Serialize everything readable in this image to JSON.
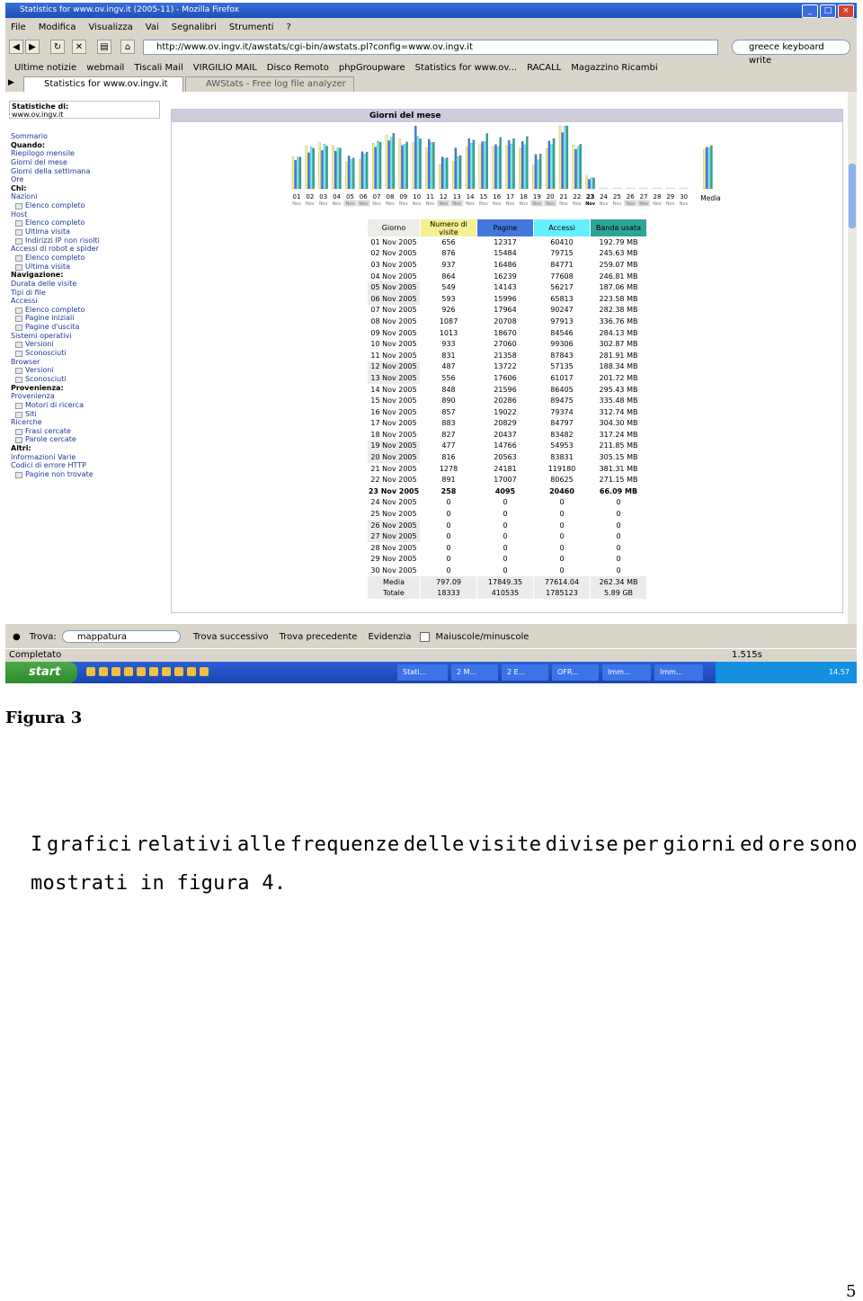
{
  "window": {
    "title": "Statistics for www.ov.ingv.it (2005-11) - Mozilla Firefox",
    "controls": [
      "_",
      "□",
      "×"
    ]
  },
  "menu": [
    "File",
    "Modifica",
    "Visualizza",
    "Vai",
    "Segnalibri",
    "Strumenti",
    "?"
  ],
  "navbar": {
    "url": "http://www.ov.ingv.it/awstats/cgi-bin/awstats.pl?config=www.ov.ingv.it",
    "search": "greece keyboard write"
  },
  "bookmarks": [
    "Ultime notizie",
    "webmail",
    "Tiscali Mail",
    "VIRGILIO MAIL",
    "Disco Remoto",
    "phpGroupware",
    "Statistics for www.ov...",
    "RACALL",
    "Magazzino Ricambi"
  ],
  "tabs": [
    "Statistics for www.ov.ingv.it (20...",
    "AWStats - Free log file analyzer ..."
  ],
  "sidebar": {
    "stats_label": "Statistiche di:",
    "site": "www.ov.ingv.it",
    "items": [
      {
        "t": "Sommario",
        "k": "link"
      },
      {
        "t": "Quando:",
        "k": "head"
      },
      {
        "t": "Riepilogo mensile",
        "k": "link"
      },
      {
        "t": "Giorni del mese",
        "k": "link"
      },
      {
        "t": "Giorni della settimana",
        "k": "link"
      },
      {
        "t": "Ore",
        "k": "link"
      },
      {
        "t": "Chi:",
        "k": "head"
      },
      {
        "t": "Nazioni",
        "k": "link"
      },
      {
        "t": "Elenco completo",
        "k": "sub"
      },
      {
        "t": "Host",
        "k": "link"
      },
      {
        "t": "Elenco completo",
        "k": "sub"
      },
      {
        "t": "Ultima visita",
        "k": "sub"
      },
      {
        "t": "Indirizzi IP non risolti",
        "k": "sub"
      },
      {
        "t": "Accessi di robot e spider",
        "k": "link"
      },
      {
        "t": "Elenco completo",
        "k": "sub"
      },
      {
        "t": "Ultima visita",
        "k": "sub"
      },
      {
        "t": "Navigazione:",
        "k": "head"
      },
      {
        "t": "Durata delle visite",
        "k": "link"
      },
      {
        "t": "Tipi di file",
        "k": "link"
      },
      {
        "t": "Accessi",
        "k": "link"
      },
      {
        "t": "Elenco completo",
        "k": "sub"
      },
      {
        "t": "Pagine iniziali",
        "k": "sub"
      },
      {
        "t": "Pagine d'uscita",
        "k": "sub"
      },
      {
        "t": "Sistemi operativi",
        "k": "link"
      },
      {
        "t": "Versioni",
        "k": "sub"
      },
      {
        "t": "Sconosciuti",
        "k": "sub"
      },
      {
        "t": "Browser",
        "k": "link"
      },
      {
        "t": "Versioni",
        "k": "sub"
      },
      {
        "t": "Sconosciuti",
        "k": "sub"
      },
      {
        "t": "Provenienza:",
        "k": "head"
      },
      {
        "t": "Provenienza",
        "k": "link"
      },
      {
        "t": "Motori di ricerca",
        "k": "sub"
      },
      {
        "t": "Siti",
        "k": "sub"
      },
      {
        "t": "Ricerche",
        "k": "link"
      },
      {
        "t": "Frasi cercate",
        "k": "sub"
      },
      {
        "t": "Parole cercate",
        "k": "sub"
      },
      {
        "t": "Altri:",
        "k": "head"
      },
      {
        "t": "Informazioni Varie",
        "k": "link"
      },
      {
        "t": "Codici di errore HTTP",
        "k": "link"
      },
      {
        "t": "Pagine non trovate",
        "k": "sub"
      }
    ]
  },
  "panel_title": "Giorni del mese",
  "chart_data": {
    "type": "bar",
    "categories": [
      "01",
      "02",
      "03",
      "04",
      "05",
      "06",
      "07",
      "08",
      "09",
      "10",
      "11",
      "12",
      "13",
      "14",
      "15",
      "16",
      "17",
      "18",
      "19",
      "20",
      "21",
      "22",
      "23",
      "24",
      "25",
      "26",
      "27",
      "28",
      "29",
      "30"
    ],
    "sublabel": "Nov",
    "mean_label": "Media",
    "highlight_colors": {
      "weekend": "#dcdcdc",
      "today": "#000000"
    },
    "series": [
      {
        "name": "Numero di visite",
        "color": "#f4f090",
        "values": [
          656,
          876,
          937,
          864,
          549,
          593,
          926,
          1087,
          1013,
          933,
          831,
          487,
          556,
          848,
          890,
          857,
          883,
          827,
          477,
          816,
          1278,
          891,
          258,
          0,
          0,
          0,
          0,
          0,
          0,
          0
        ],
        "mean": 797.09
      },
      {
        "name": "Pagine",
        "color": "#4477dd",
        "values": [
          12317,
          15484,
          16486,
          16239,
          14143,
          15996,
          17964,
          20708,
          18670,
          27060,
          21358,
          13722,
          17606,
          21596,
          20286,
          19022,
          20829,
          20437,
          14766,
          20563,
          24181,
          17007,
          4095,
          0,
          0,
          0,
          0,
          0,
          0,
          0
        ],
        "mean": 17849.35
      },
      {
        "name": "Accessi",
        "color": "#66f0ff",
        "values": [
          60410,
          79715,
          84771,
          77608,
          56217,
          65813,
          90247,
          97913,
          84546,
          99306,
          87843,
          57135,
          61017,
          86405,
          89475,
          79374,
          84797,
          83482,
          54953,
          83831,
          119180,
          80625,
          20460,
          0,
          0,
          0,
          0,
          0,
          0,
          0
        ],
        "mean": 77614.04
      },
      {
        "name": "Banda usata",
        "color": "#2ea495",
        "values": [
          192.79,
          245.63,
          259.07,
          246.81,
          187.06,
          223.58,
          282.38,
          336.76,
          284.13,
          302.87,
          281.91,
          188.34,
          201.72,
          295.43,
          335.48,
          312.74,
          304.3,
          317.24,
          211.85,
          305.15,
          381.31,
          271.15,
          66.09,
          0,
          0,
          0,
          0,
          0,
          0,
          0
        ],
        "mean": 262.34
      }
    ]
  },
  "table": {
    "headers": [
      "Giorno",
      "Numero di visite",
      "Pagine",
      "Accessi",
      "Banda usata"
    ],
    "header_colors": [
      "#ecece8",
      "#f4f090",
      "#4477dd",
      "#66f0ff",
      "#2ea495"
    ],
    "rows": [
      [
        "01 Nov 2005",
        "656",
        "12317",
        "60410",
        "192.79 MB"
      ],
      [
        "02 Nov 2005",
        "876",
        "15484",
        "79715",
        "245.63 MB"
      ],
      [
        "03 Nov 2005",
        "937",
        "16486",
        "84771",
        "259.07 MB"
      ],
      [
        "04 Nov 2005",
        "864",
        "16239",
        "77608",
        "246.81 MB"
      ],
      [
        "05 Nov 2005",
        "549",
        "14143",
        "56217",
        "187.06 MB"
      ],
      [
        "06 Nov 2005",
        "593",
        "15996",
        "65813",
        "223.58 MB"
      ],
      [
        "07 Nov 2005",
        "926",
        "17964",
        "90247",
        "282.38 MB"
      ],
      [
        "08 Nov 2005",
        "1087",
        "20708",
        "97913",
        "336.76 MB"
      ],
      [
        "09 Nov 2005",
        "1013",
        "18670",
        "84546",
        "284.13 MB"
      ],
      [
        "10 Nov 2005",
        "933",
        "27060",
        "99306",
        "302.87 MB"
      ],
      [
        "11 Nov 2005",
        "831",
        "21358",
        "87843",
        "281.91 MB"
      ],
      [
        "12 Nov 2005",
        "487",
        "13722",
        "57135",
        "188.34 MB"
      ],
      [
        "13 Nov 2005",
        "556",
        "17606",
        "61017",
        "201.72 MB"
      ],
      [
        "14 Nov 2005",
        "848",
        "21596",
        "86405",
        "295.43 MB"
      ],
      [
        "15 Nov 2005",
        "890",
        "20286",
        "89475",
        "335.48 MB"
      ],
      [
        "16 Nov 2005",
        "857",
        "19022",
        "79374",
        "312.74 MB"
      ],
      [
        "17 Nov 2005",
        "883",
        "20829",
        "84797",
        "304.30 MB"
      ],
      [
        "18 Nov 2005",
        "827",
        "20437",
        "83482",
        "317.24 MB"
      ],
      [
        "19 Nov 2005",
        "477",
        "14766",
        "54953",
        "211.85 MB"
      ],
      [
        "20 Nov 2005",
        "816",
        "20563",
        "83831",
        "305.15 MB"
      ],
      [
        "21 Nov 2005",
        "1278",
        "24181",
        "119180",
        "381.31 MB"
      ],
      [
        "22 Nov 2005",
        "891",
        "17007",
        "80625",
        "271.15 MB"
      ],
      [
        "23 Nov 2005",
        "258",
        "4095",
        "20460",
        "66.09 MB"
      ],
      [
        "24 Nov 2005",
        "0",
        "0",
        "0",
        "0"
      ],
      [
        "25 Nov 2005",
        "0",
        "0",
        "0",
        "0"
      ],
      [
        "26 Nov 2005",
        "0",
        "0",
        "0",
        "0"
      ],
      [
        "27 Nov 2005",
        "0",
        "0",
        "0",
        "0"
      ],
      [
        "28 Nov 2005",
        "0",
        "0",
        "0",
        "0"
      ],
      [
        "29 Nov 2005",
        "0",
        "0",
        "0",
        "0"
      ],
      [
        "30 Nov 2005",
        "0",
        "0",
        "0",
        "0"
      ]
    ],
    "bold_row": 22,
    "weekend_rows": [
      4,
      5,
      11,
      12,
      18,
      19,
      25,
      26
    ],
    "summary": [
      [
        "Media",
        "797.09",
        "17849.35",
        "77614.04",
        "262.34 MB"
      ],
      [
        "Totale",
        "18333",
        "410535",
        "1785123",
        "5.89 GB"
      ]
    ]
  },
  "findbar": {
    "label": "Trova:",
    "value": "mappatura",
    "next": "Trova successivo",
    "prev": "Trova precedente",
    "highlight": "Evidenzia",
    "match_case": "Maiuscole/minuscole"
  },
  "status": {
    "text": "Completato",
    "time": "1.515s"
  },
  "taskbar": {
    "start": "start",
    "tasks": [
      "Stati...",
      "2 M...",
      "2 E...",
      "OFR...",
      "Imm...",
      "Imm..."
    ],
    "clock": "14.57"
  },
  "document": {
    "caption": "Figura 3",
    "paragraph_line1": [
      "I",
      "grafici",
      "relativi",
      "alle",
      "frequenze",
      "delle",
      "visite",
      "divise",
      "per",
      "giorni",
      "ed",
      "ore",
      "sono"
    ],
    "paragraph_line2": "mostrati in figura 4.",
    "page_number": "5"
  }
}
